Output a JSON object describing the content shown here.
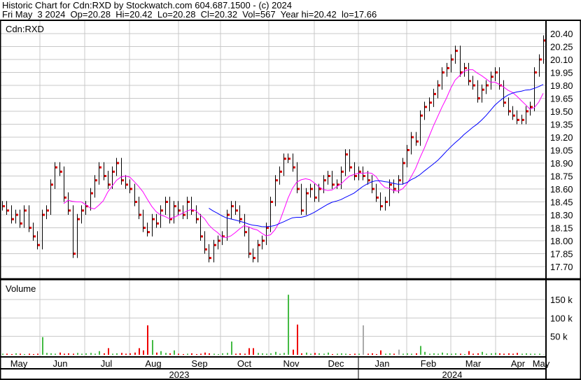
{
  "header": {
    "title": "Historic Chart for Cdn:RXD by Stockwatch.com 604.687.1500 - (c) 2024",
    "quote": "Fri May  3 2024  Op=20.28  Hi=20.42  Lo=20.28  Cl=20.32  Vol=567  Year hi=20.42  lo=17.66"
  },
  "colors": {
    "up": "#e00000",
    "down": "#e00000",
    "bar": "#000000",
    "ma_short": "#ff00ff",
    "ma_long": "#0000ff",
    "vol_up": "#44bb44",
    "vol_down": "#ee0000",
    "vol_flat": "#aaaaaa",
    "grid": "#c8c8c8"
  },
  "chart_data": {
    "type": "ohlc",
    "price_label": "Cdn:RXD",
    "volume_label": "Volume",
    "ylim": [
      17.6,
      20.5
    ],
    "price_ticks": [
      "20.40",
      "20.25",
      "20.10",
      "19.95",
      "19.80",
      "19.65",
      "19.50",
      "19.35",
      "19.20",
      "19.05",
      "18.90",
      "18.75",
      "18.60",
      "18.45",
      "18.30",
      "18.15",
      "18.00",
      "17.85",
      "17.70"
    ],
    "volume_ticks": [
      {
        "v": 150000,
        "label": "150 k"
      },
      {
        "v": 100000,
        "label": "100 k"
      },
      {
        "v": 50000,
        "label": "50 k"
      }
    ],
    "months": [
      "May",
      "Jun",
      "Jul",
      "Aug",
      "Sep",
      "Oct",
      "Nov",
      "Dec",
      "Jan",
      "Feb",
      "Mar",
      "Apr",
      "May"
    ],
    "years": [
      "2023",
      "2024"
    ],
    "closes": [
      18.4,
      18.35,
      18.25,
      18.3,
      18.2,
      18.35,
      18.15,
      18.05,
      17.95,
      18.3,
      18.35,
      18.65,
      18.85,
      18.8,
      18.5,
      18.35,
      17.85,
      18.25,
      18.35,
      18.4,
      18.55,
      18.7,
      18.85,
      18.75,
      18.65,
      18.8,
      18.9,
      18.7,
      18.65,
      18.6,
      18.45,
      18.3,
      18.15,
      18.1,
      18.25,
      18.2,
      18.35,
      18.45,
      18.25,
      18.4,
      18.35,
      18.3,
      18.45,
      18.35,
      18.25,
      18.05,
      17.9,
      17.8,
      17.95,
      18.0,
      18.05,
      18.3,
      18.4,
      18.35,
      18.25,
      18.1,
      17.85,
      17.8,
      17.95,
      18.0,
      18.15,
      18.45,
      18.7,
      18.8,
      18.95,
      18.95,
      18.85,
      18.6,
      18.35,
      18.55,
      18.6,
      18.5,
      18.6,
      18.7,
      18.75,
      18.65,
      18.65,
      18.8,
      19.0,
      18.85,
      18.75,
      18.8,
      18.75,
      18.7,
      18.6,
      18.5,
      18.4,
      18.45,
      18.65,
      18.6,
      18.7,
      18.9,
      19.05,
      19.2,
      19.15,
      19.45,
      19.55,
      19.6,
      19.7,
      19.8,
      19.95,
      20.0,
      20.1,
      20.2,
      19.95,
      20.0,
      19.85,
      19.8,
      19.65,
      19.75,
      19.8,
      19.9,
      19.95,
      19.8,
      19.6,
      19.5,
      19.45,
      19.4,
      19.4,
      19.5,
      19.55,
      19.95,
      20.1,
      20.32
    ],
    "volumes": [
      3000,
      3000,
      2000,
      4000,
      3000,
      2000,
      3000,
      2000,
      3000,
      48000,
      5000,
      4000,
      3000,
      6000,
      3000,
      4000,
      3000,
      5000,
      3000,
      4000,
      5000,
      3000,
      10000,
      4000,
      18000,
      3000,
      4000,
      5000,
      3000,
      4000,
      6000,
      18000,
      12000,
      80000,
      40000,
      6000,
      10000,
      5000,
      4000,
      12000,
      3000,
      2000,
      3000,
      4000,
      2000,
      3000,
      6000,
      4000,
      3000,
      2000,
      4000,
      5000,
      36000,
      3000,
      4000,
      3000,
      18000,
      18000,
      5000,
      4000,
      3000,
      4000,
      8000,
      3000,
      5000,
      163000,
      14000,
      82000,
      4000,
      6000,
      3000,
      5000,
      4000,
      3000,
      6000,
      2000,
      3000,
      4000,
      3000,
      2000,
      3000,
      3000,
      80000,
      3000,
      4000,
      2000,
      12000,
      3000,
      4000,
      3000,
      14000,
      3000,
      4000,
      3000,
      4000,
      24000,
      8000,
      3000,
      4000,
      3000,
      6000,
      4000,
      3000,
      4000,
      3000,
      2000,
      10000,
      3000,
      4000,
      8000,
      3000,
      4000,
      5000,
      4000,
      3000,
      4000,
      3000,
      5000,
      3000,
      4000,
      3000,
      3000,
      3000,
      567
    ]
  }
}
